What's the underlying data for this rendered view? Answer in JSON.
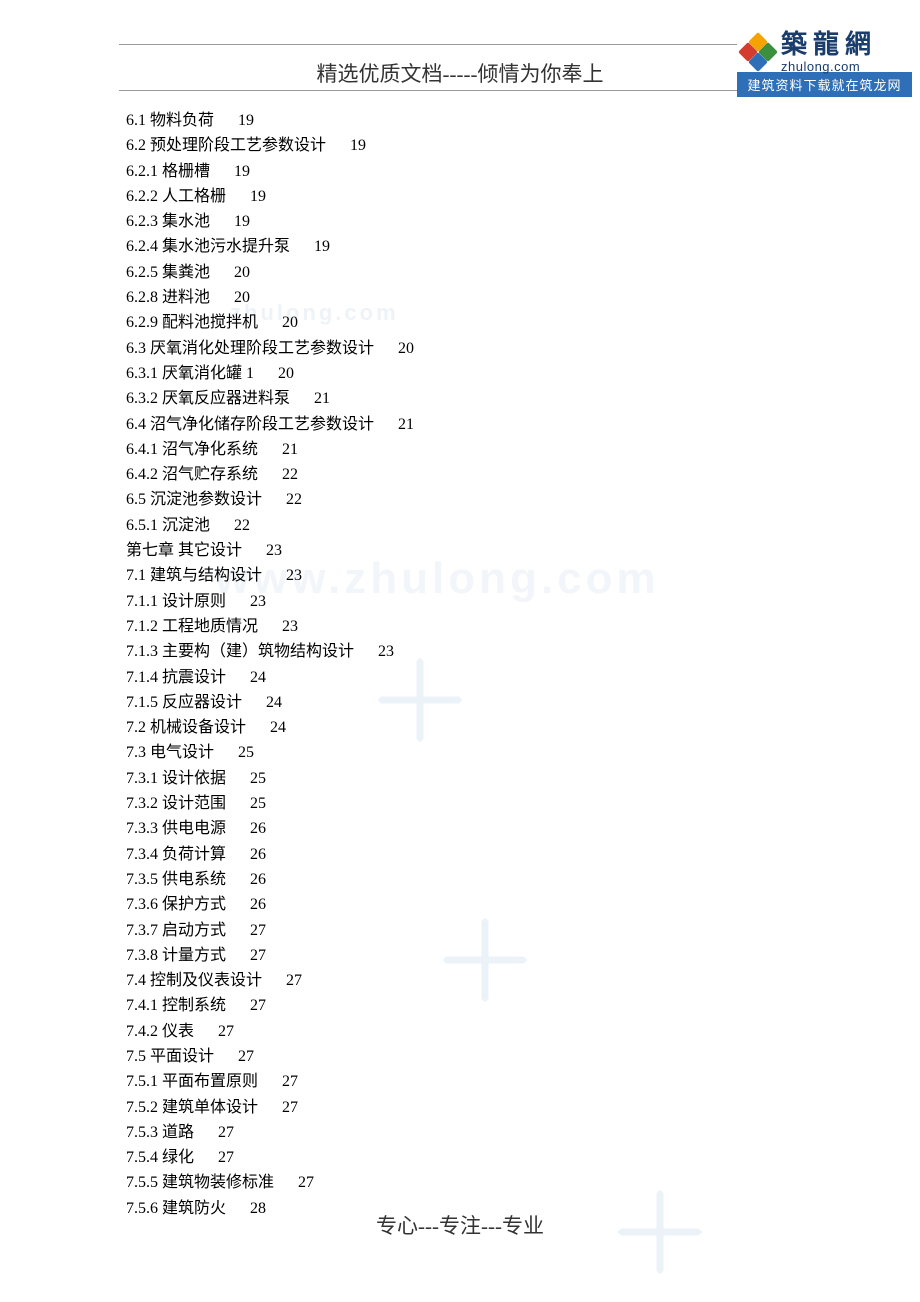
{
  "header": {
    "title": "精选优质文档-----倾情为你奉上"
  },
  "logo": {
    "cn": "築龍網",
    "en": "zhulong.com",
    "banner": "建筑资料下载就在筑龙网"
  },
  "footer": {
    "text": "专心---专注---专业"
  },
  "watermarks": {
    "small": "zhulong.com",
    "large": "www.zhulong.com"
  },
  "toc": [
    {
      "num": "6.1",
      "title": "物料负荷",
      "page": "19"
    },
    {
      "num": "6.2",
      "title": "预处理阶段工艺参数设计",
      "page": "19"
    },
    {
      "num": "6.2.1",
      "title": "格栅槽",
      "page": "19"
    },
    {
      "num": "6.2.2",
      "title": "人工格栅",
      "page": "19"
    },
    {
      "num": "6.2.3",
      "title": "集水池",
      "page": "19"
    },
    {
      "num": "6.2.4",
      "title": "集水池污水提升泵",
      "page": "19"
    },
    {
      "num": "6.2.5",
      "title": "集粪池",
      "page": "20"
    },
    {
      "num": "6.2.8",
      "title": "进料池",
      "page": "20"
    },
    {
      "num": "6.2.9",
      "title": "配料池搅拌机",
      "page": "20"
    },
    {
      "num": "6.3",
      "title": "厌氧消化处理阶段工艺参数设计",
      "page": "20"
    },
    {
      "num": "6.3.1",
      "title": "厌氧消化罐 1",
      "page": "20"
    },
    {
      "num": "6.3.2",
      "title": "厌氧反应器进料泵",
      "page": "21"
    },
    {
      "num": "6.4",
      "title": "沼气净化储存阶段工艺参数设计",
      "page": "21"
    },
    {
      "num": "6.4.1",
      "title": "沼气净化系统",
      "page": "21"
    },
    {
      "num": "6.4.2",
      "title": "沼气贮存系统",
      "page": "22"
    },
    {
      "num": "6.5",
      "title": "沉淀池参数设计",
      "page": "22"
    },
    {
      "num": "6.5.1",
      "title": "沉淀池",
      "page": "22"
    },
    {
      "num": "第七章",
      "title": "其它设计",
      "page": "23"
    },
    {
      "num": "7.1",
      "title": "建筑与结构设计",
      "page": "23"
    },
    {
      "num": "7.1.1",
      "title": "设计原则",
      "page": "23"
    },
    {
      "num": "7.1.2",
      "title": "工程地质情况",
      "page": "23"
    },
    {
      "num": "7.1.3",
      "title": "主要构（建）筑物结构设计",
      "page": "23"
    },
    {
      "num": "7.1.4",
      "title": "抗震设计",
      "page": "24"
    },
    {
      "num": "7.1.5",
      "title": "反应器设计",
      "page": "24"
    },
    {
      "num": "7.2",
      "title": "机械设备设计",
      "page": "24"
    },
    {
      "num": "7.3",
      "title": "电气设计",
      "page": "25"
    },
    {
      "num": "7.3.1",
      "title": "设计依据",
      "page": "25"
    },
    {
      "num": "7.3.2",
      "title": "设计范围",
      "page": "25"
    },
    {
      "num": "7.3.3",
      "title": "供电电源",
      "page": "26"
    },
    {
      "num": "7.3.4",
      "title": "负荷计算",
      "page": "26"
    },
    {
      "num": "7.3.5",
      "title": "供电系统",
      "page": "26"
    },
    {
      "num": "7.3.6",
      "title": "保护方式",
      "page": "26"
    },
    {
      "num": "7.3.7",
      "title": "启动方式",
      "page": "27"
    },
    {
      "num": "7.3.8",
      "title": "计量方式",
      "page": "27"
    },
    {
      "num": "7.4",
      "title": "控制及仪表设计",
      "page": "27"
    },
    {
      "num": "7.4.1",
      "title": "控制系统",
      "page": "27"
    },
    {
      "num": "7.4.2",
      "title": "仪表",
      "page": "27"
    },
    {
      "num": "7.5",
      "title": "平面设计",
      "page": "27"
    },
    {
      "num": "7.5.1",
      "title": "平面布置原则",
      "page": "27"
    },
    {
      "num": "7.5.2",
      "title": "建筑单体设计",
      "page": "27"
    },
    {
      "num": "7.5.3",
      "title": "道路",
      "page": "27"
    },
    {
      "num": "7.5.4",
      "title": "绿化",
      "page": "27"
    },
    {
      "num": "7.5.5",
      "title": "建筑物装修标准",
      "page": "27"
    },
    {
      "num": "7.5.6",
      "title": "建筑防火",
      "page": "28"
    }
  ]
}
